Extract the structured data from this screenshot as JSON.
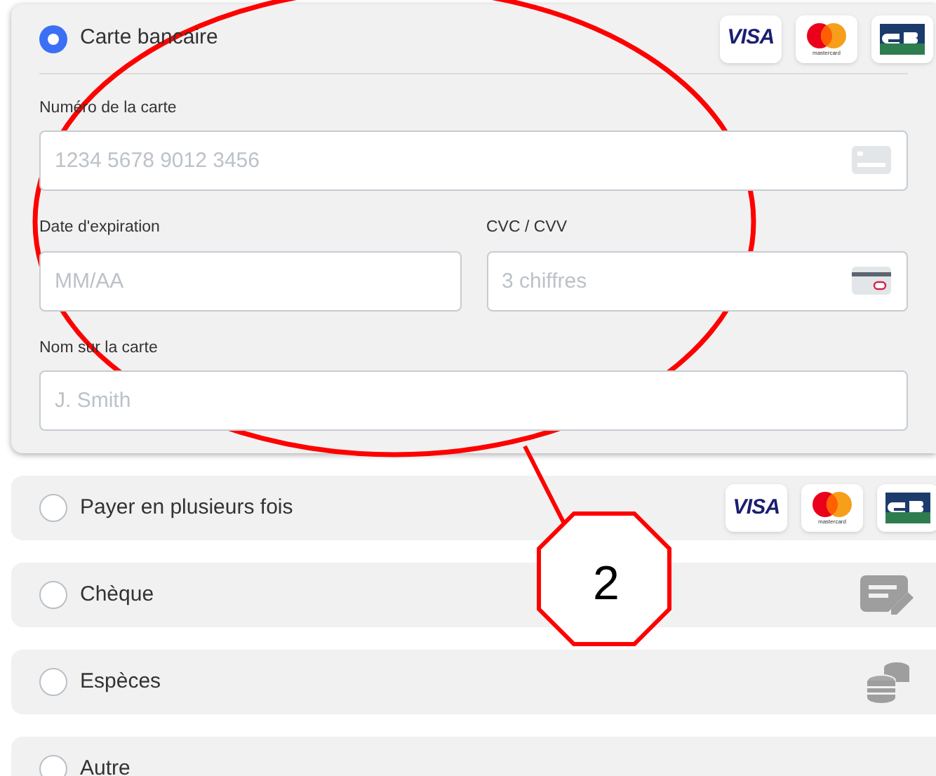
{
  "payment_methods": [
    {
      "label": "Carte bancaire",
      "selected": true,
      "kind": "card_form",
      "logos": [
        {
          "kind": "visa",
          "text": "VISA"
        },
        {
          "kind": "mastercard",
          "text": "mastercard"
        },
        {
          "kind": "cb"
        }
      ],
      "field_rows": [
        {
          "fields": [
            {
              "label": "Numéro de la carte",
              "placeholder": "1234 5678 9012 3456",
              "kind": "card_number"
            }
          ]
        },
        {
          "fields": [
            {
              "label": "Date d'expiration",
              "placeholder": "MM/AA",
              "kind": "plain"
            },
            {
              "label": "CVC / CVV",
              "placeholder": "3 chiffres",
              "kind": "cvc"
            }
          ]
        },
        {
          "fields": [
            {
              "label": "Nom sur la carte",
              "placeholder": "J. Smith",
              "kind": "plain"
            }
          ]
        }
      ]
    },
    {
      "label": "Payer en plusieurs fois",
      "selected": false,
      "kind": "cards",
      "logos": [
        {
          "kind": "visa",
          "text": "VISA"
        },
        {
          "kind": "mastercard",
          "text": "mastercard"
        },
        {
          "kind": "cb"
        }
      ]
    },
    {
      "label": "Chèque",
      "selected": false,
      "kind": "cheque"
    },
    {
      "label": "Espèces",
      "selected": false,
      "kind": "cash"
    },
    {
      "label": "Autre",
      "selected": false,
      "kind": "plain"
    }
  ],
  "callout": {
    "number": "2"
  }
}
